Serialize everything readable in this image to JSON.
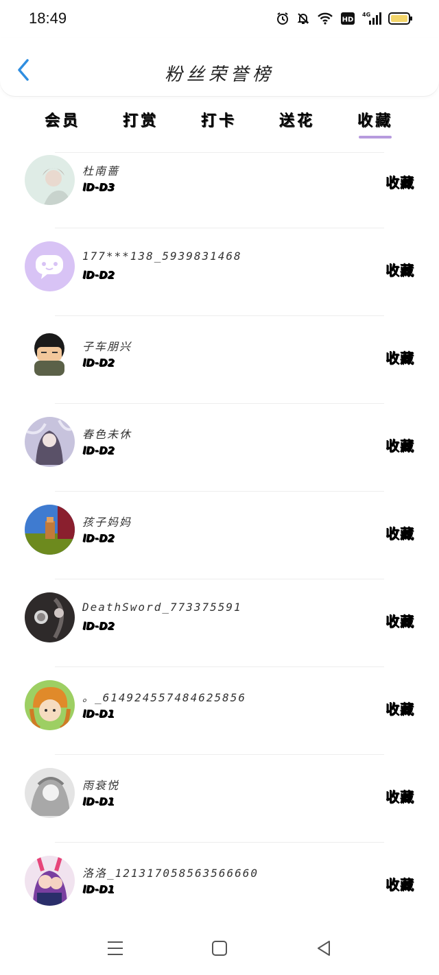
{
  "status_bar": {
    "time": "18:49",
    "icons": [
      "alarm-icon",
      "bell-muted-icon",
      "wifi-icon",
      "hd-icon",
      "signal-4g-icon",
      "battery-icon"
    ],
    "hd_label": "HD",
    "network_label": "4G"
  },
  "header": {
    "title": "粉丝荣誉榜",
    "back_icon": "chevron-left-icon",
    "accent_color": "#2f8ee0"
  },
  "tabs": [
    {
      "label": "会员"
    },
    {
      "label": "打赏"
    },
    {
      "label": "打卡"
    },
    {
      "label": "送花"
    },
    {
      "label": "收藏"
    }
  ],
  "active_tab": "收藏",
  "indicator_color": "#b79bde",
  "fans": [
    {
      "name": "杜南蔷",
      "level": "lD-D3",
      "action": "收藏"
    },
    {
      "name": "177***138_5939831468",
      "level": "lD-D2",
      "action": "收藏"
    },
    {
      "name": "子车朋兴",
      "level": "lD-D2",
      "action": "收藏"
    },
    {
      "name": "春色未休",
      "level": "lD-D2",
      "action": "收藏"
    },
    {
      "name": "孩子妈妈",
      "level": "lD-D2",
      "action": "收藏"
    },
    {
      "name": "DeathSword_773375591",
      "level": "lD-D2",
      "action": "收藏"
    },
    {
      "name": "。_614924557484625856",
      "level": "lD-D1",
      "action": "收藏"
    },
    {
      "name": "雨衰悦",
      "level": "lD-D1",
      "action": "收藏"
    },
    {
      "name": "洛洛_121317058563566660",
      "level": "lD-D1",
      "action": "收藏"
    }
  ],
  "nav_bar": {
    "icons": [
      "menu-icon",
      "home-square-icon",
      "back-triangle-icon"
    ]
  }
}
